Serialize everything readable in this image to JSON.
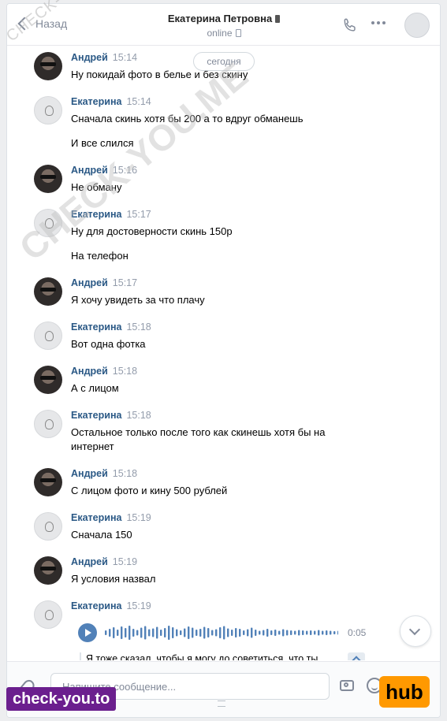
{
  "header": {
    "back_label": "Назад",
    "contact_name": "Екатерина Петровна",
    "status": "online"
  },
  "date_divider": "сегодня",
  "messages": [
    {
      "author": "Андрей",
      "time": "15:14",
      "lines": [
        "Ну покидай фото в белье и без скину"
      ]
    },
    {
      "author": "Екатерина",
      "time": "15:14",
      "lines": [
        "Сначала скинь хотя бы 200 а то вдруг обманешь",
        "И все слился"
      ]
    },
    {
      "author": "Андрей",
      "time": "15:16",
      "lines": [
        "Не обману"
      ]
    },
    {
      "author": "Екатерина",
      "time": "15:17",
      "lines": [
        "Ну для достоверности скинь 150р",
        "На телефон"
      ]
    },
    {
      "author": "Андрей",
      "time": "15:17",
      "lines": [
        "Я хочу увидеть за что плачу"
      ]
    },
    {
      "author": "Екатерина",
      "time": "15:18",
      "lines": [
        "Вот одна фотка"
      ]
    },
    {
      "author": "Андрей",
      "time": "15:18",
      "lines": [
        "А с лицом"
      ]
    },
    {
      "author": "Екатерина",
      "time": "15:18",
      "lines": [
        "Остальное только после того как скинешь хотя бы на",
        "интернет"
      ]
    },
    {
      "author": "Андрей",
      "time": "15:18",
      "lines": [
        "С лицом фото и кину 500 рублей"
      ]
    },
    {
      "author": "Екатерина",
      "time": "15:19",
      "lines": [
        "Сначала 150"
      ]
    },
    {
      "author": "Андрей",
      "time": "15:19",
      "lines": [
        "Я условия назвал"
      ]
    },
    {
      "author": "Екатерина",
      "time": "15:19",
      "lines": []
    }
  ],
  "voice_message": {
    "duration": "0:05",
    "transcript": "Я тоже сказал, чтобы я могу до советиться, что ты"
  },
  "composer": {
    "placeholder": "Напишите сообщение..."
  },
  "watermarks": {
    "small": "CHECK-YOU.ME",
    "large": "CHECK-YOU.ME",
    "bottom_left": "check-you.to",
    "bottom_right": "hub"
  },
  "colors": {
    "author": "#2a5885",
    "accent": "#5181b8",
    "muted": "#828a99"
  }
}
